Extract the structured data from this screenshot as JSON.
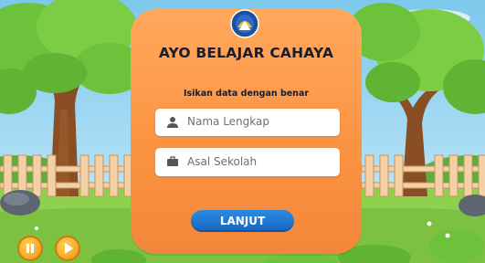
{
  "app": {
    "title": "AYO BELAJAR CAHAYA",
    "instruction": "Isikan data dengan benar"
  },
  "form": {
    "name_placeholder": "Nama Lengkap",
    "school_placeholder": "Asal Sekolah",
    "name_icon": "user-icon",
    "school_icon": "briefcase-icon"
  },
  "actions": {
    "next_label": "LANJUT"
  },
  "controls": {
    "pause_icon": "pause-icon",
    "play_icon": "play-icon"
  },
  "colors": {
    "card": "#fb9442",
    "button": "#1e78d4",
    "control": "#f5a623",
    "sky": "#8fd2f0",
    "grass": "#8fd14f"
  }
}
